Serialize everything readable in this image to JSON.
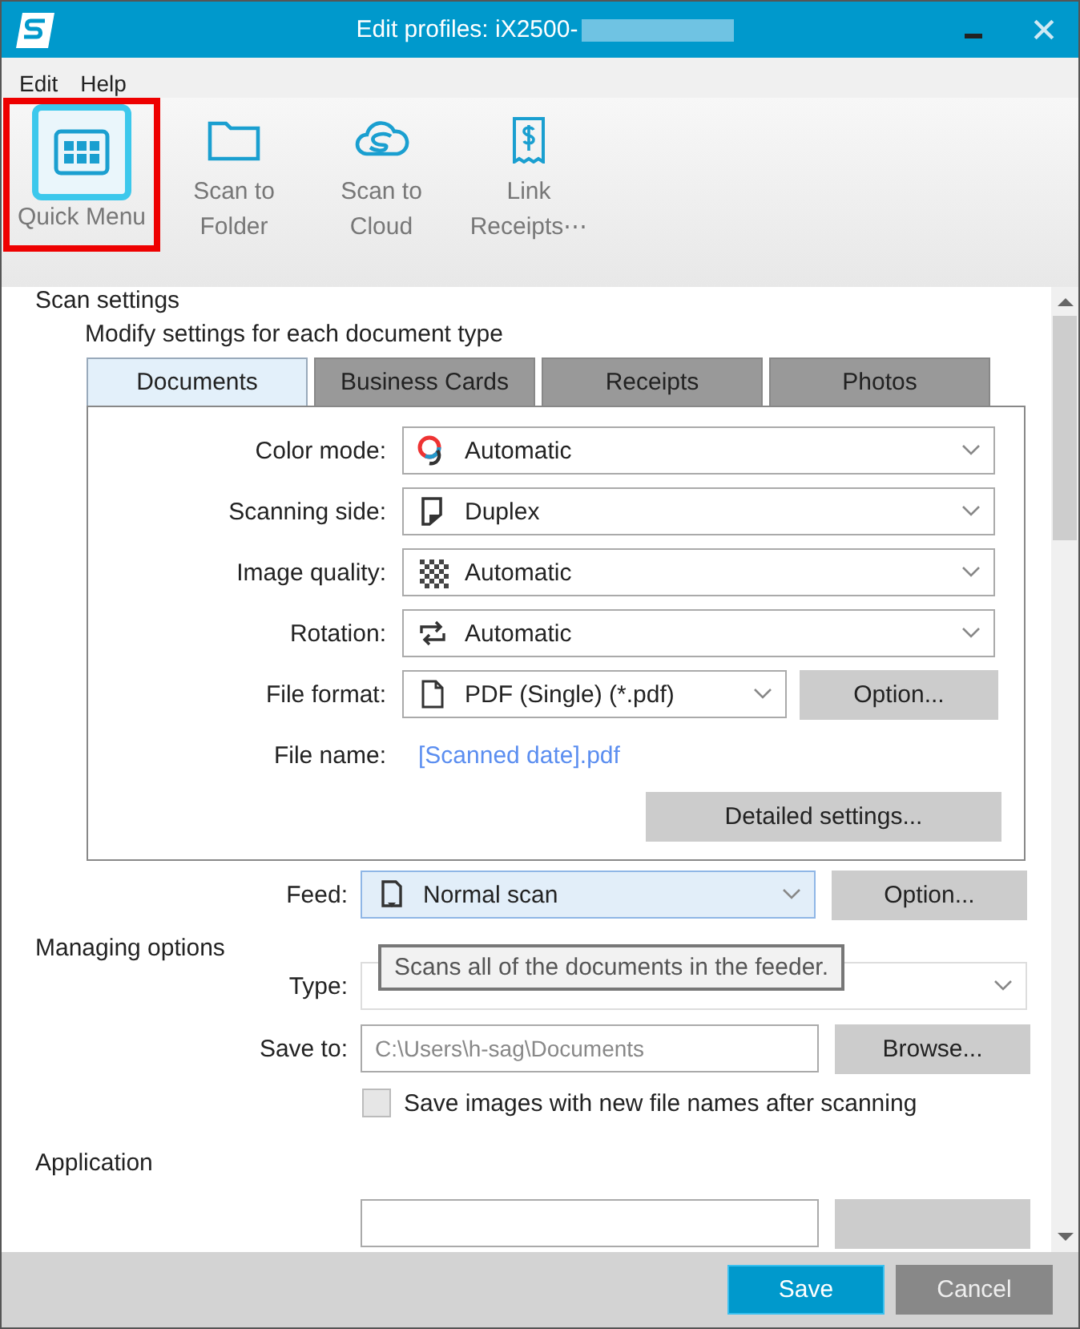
{
  "window": {
    "title": "Edit profiles: iX2500-"
  },
  "menu": [
    "Edit",
    "Help"
  ],
  "toolbar": [
    {
      "label": "Quick Menu",
      "kind": "grid",
      "selected": true,
      "highlighted": true
    },
    {
      "label": "Scan to Folder",
      "kind": "folder",
      "selected": false,
      "highlighted": false
    },
    {
      "label": "Scan to Cloud",
      "kind": "cloud",
      "selected": false,
      "highlighted": false
    },
    {
      "label": "Link Receipts⋯",
      "kind": "receipt",
      "selected": false,
      "highlighted": false
    }
  ],
  "scan_settings": {
    "heading": "Scan settings",
    "subheading": "Modify settings for each document type",
    "tabs": [
      {
        "label": "Documents",
        "selected": true
      },
      {
        "label": "Business Cards",
        "selected": false
      },
      {
        "label": "Receipts",
        "selected": false
      },
      {
        "label": "Photos",
        "selected": false
      }
    ],
    "fields": [
      {
        "kind": "dropdown",
        "label": "Color mode:",
        "value": "Automatic"
      },
      {
        "kind": "dropdown",
        "label": "Scanning side:",
        "value": "Duplex"
      },
      {
        "kind": "dropdown",
        "label": "Image quality:",
        "value": "Automatic"
      },
      {
        "kind": "dropdown",
        "label": "Rotation:",
        "value": "Automatic"
      },
      {
        "kind": "dropdown_button",
        "label": "File format:",
        "value": "PDF (Single) (*.pdf)",
        "button": "Option..."
      },
      {
        "kind": "link",
        "label": "File name:",
        "value": "[Scanned date].pdf"
      }
    ],
    "detailed_button": "Detailed settings..."
  },
  "feed": {
    "label": "Feed:",
    "value": "Normal scan",
    "button": "Option...",
    "focused": true
  },
  "tooltip": "Scans all of the documents in the feeder.",
  "managing": {
    "heading": "Managing options",
    "type_label": "Type:",
    "type_disabled": true,
    "save_to_label": "Save to:",
    "save_to_value": "C:\\Users\\h-sag\\Documents",
    "browse_button": "Browse...",
    "checkbox": {
      "label": "Save images with new file names after scanning",
      "checked": false
    }
  },
  "application": {
    "heading": "Application"
  },
  "buttons": [
    {
      "label": "Save",
      "kind": "primary"
    },
    {
      "label": "Cancel",
      "kind": "secondary"
    }
  ]
}
